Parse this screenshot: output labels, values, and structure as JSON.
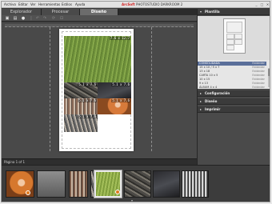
{
  "menu": {
    "items": [
      "Archivo",
      "Editar",
      "Ver",
      "Herramientas",
      "Estilos",
      "Ayuda"
    ],
    "title_brand": "ArcSoft",
    "title_rest": "PHOTOSTUDIO DARKROOM 2",
    "window_buttons": [
      "_",
      "□",
      "✕"
    ]
  },
  "tabs": [
    {
      "label": "Explorador",
      "active": false
    },
    {
      "label": "Procesar",
      "active": false
    },
    {
      "label": "Diseño",
      "active": true
    }
  ],
  "toolbar": {
    "buttons": [
      {
        "name": "save-icon",
        "glyph": "▣"
      },
      {
        "name": "print-icon",
        "glyph": "▤"
      },
      {
        "name": "email-icon",
        "glyph": "●"
      },
      {
        "name": "separator-icon",
        "glyph": "|"
      },
      {
        "name": "undo-icon",
        "glyph": "↶"
      },
      {
        "name": "redo-icon",
        "glyph": "↷"
      },
      {
        "name": "rotate-icon",
        "glyph": "⟳"
      },
      {
        "name": "crop-icon",
        "glyph": "⊡"
      }
    ]
  },
  "canvas": {
    "photos": [
      {
        "id": "grass",
        "label": "7.6 x 12.7"
      },
      {
        "id": "stones",
        "label": "5.1 x 7.6"
      },
      {
        "id": "dark",
        "label": "5.1 x 7.6"
      },
      {
        "id": "building",
        "label": "5.1 x 7.6"
      },
      {
        "id": "orange",
        "label": "5.1 x 7.6"
      },
      {
        "id": "street",
        "label": "5.1 x 7.6"
      }
    ]
  },
  "status": {
    "page": "Página 1 of 1"
  },
  "right_panel": {
    "sections": [
      {
        "label": "Plantilla",
        "expanded": true
      },
      {
        "label": "Configuración",
        "expanded": false
      },
      {
        "label": "Diseño",
        "expanded": false
      },
      {
        "label": "Imprimir",
        "expanded": false
      }
    ],
    "templates": [
      {
        "name": "CONSOLIDADA",
        "type": "Estándar",
        "selected": true
      },
      {
        "name": "15 x 10 / 5 x 7",
        "type": "Estándar",
        "selected": false
      },
      {
        "name": "13 x 18",
        "type": "Estándar",
        "selected": false
      },
      {
        "name": "CARTA 10 x 5",
        "type": "Estándar",
        "selected": false
      },
      {
        "name": "10 x 15",
        "type": "Estándar",
        "selected": false
      },
      {
        "name": "9 x 13",
        "type": "Estándar",
        "selected": false
      },
      {
        "name": "ÁLBUM 4 x 4",
        "type": "Estándar",
        "selected": false
      }
    ]
  },
  "filmstrip": {
    "thumbs": [
      {
        "name": "thumb-orange-photo",
        "selected": false,
        "badge": true
      },
      {
        "name": "thumb-grey-photo",
        "selected": false,
        "badge": false
      },
      {
        "name": "thumb-building-photo",
        "selected": false,
        "badge": false
      },
      {
        "name": "thumb-street-photo",
        "selected": false,
        "badge": false
      },
      {
        "name": "thumb-grass-photo",
        "selected": true,
        "badge": true
      },
      {
        "name": "thumb-stones-photo",
        "selected": false,
        "badge": false
      },
      {
        "name": "thumb-dark-photo",
        "selected": false,
        "badge": false
      },
      {
        "name": "thumb-temple-photo",
        "selected": false,
        "badge": false
      }
    ],
    "expand_glyph": "▾"
  },
  "colors": {
    "brand": "#d42121",
    "panel_bg": "#4a4a4a",
    "selection": "#5a6f9a",
    "badge": "#e07a1e"
  }
}
